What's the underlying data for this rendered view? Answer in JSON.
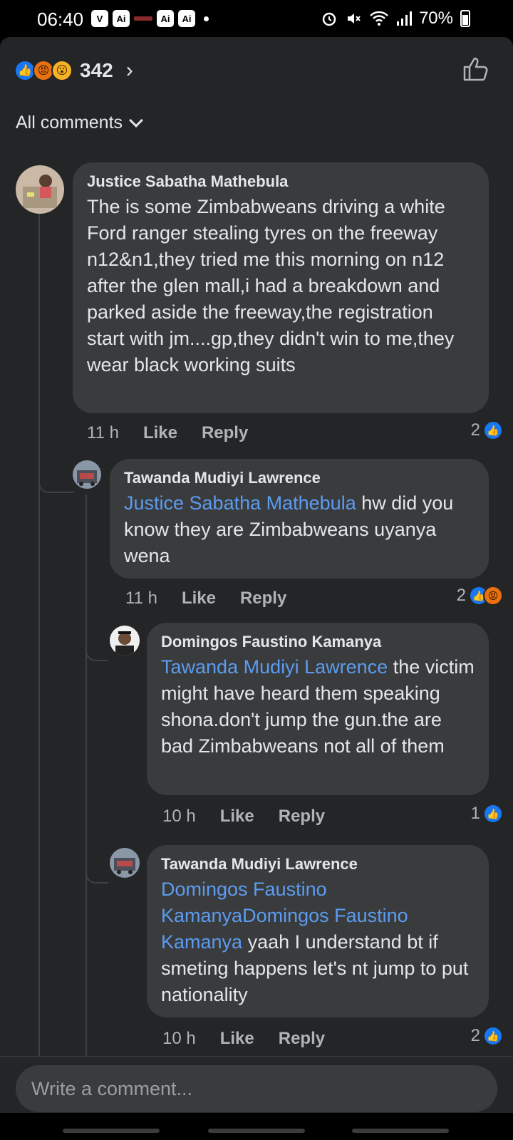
{
  "status_bar": {
    "time": "06:40",
    "left_badges": [
      "V",
      "Ai",
      "Ai",
      "Ai"
    ],
    "battery": "70%"
  },
  "reactions": {
    "count": "342",
    "types": [
      "like-icon",
      "angry-icon",
      "wow-icon"
    ]
  },
  "sort": {
    "label": "All comments"
  },
  "comments": [
    {
      "author": "Justice Sabatha Mathebula",
      "mention": "",
      "text": "The is some Zimbabweans driving a white Ford ranger stealing tyres on the freeway n12&n1,they tried me this morning on n12 after the glen mall,i had a breakdown and parked aside the freeway,the registration start with jm....gp,they didn't win to me,they wear black working suits",
      "time": "11 h",
      "like": "Like",
      "reply": "Reply",
      "reaction_count": "2"
    },
    {
      "author": "Tawanda Mudiyi Lawrence",
      "mention": "Justice Sabatha Mathebula",
      "text": " hw did you know they are Zimbabweans uyanya wena",
      "time": "11 h",
      "like": "Like",
      "reply": "Reply",
      "reaction_count": "2"
    },
    {
      "author": "Domingos Faustino Kamanya",
      "mention": "Tawanda Mudiyi Lawrence",
      "text": " the victim might have heard them speaking shona.don't jump the gun.the are bad Zimbabweans not all of them",
      "time": "10 h",
      "like": "Like",
      "reply": "Reply",
      "reaction_count": "1"
    },
    {
      "author": "Tawanda Mudiyi Lawrence",
      "mention": "Domingos Faustino KamanyaDomingos Faustino Kamanya",
      "text": " yaah I understand bt if smeting happens let's nt jump to put nationality",
      "time": "10 h",
      "like": "Like",
      "reply": "Reply",
      "reaction_count": "2"
    }
  ],
  "composer": {
    "placeholder": "Write a comment..."
  },
  "colors": {
    "background": "#242526",
    "bubble": "#3a3b3c",
    "mention": "#5b9cf0",
    "like_blue": "#1877f2"
  }
}
